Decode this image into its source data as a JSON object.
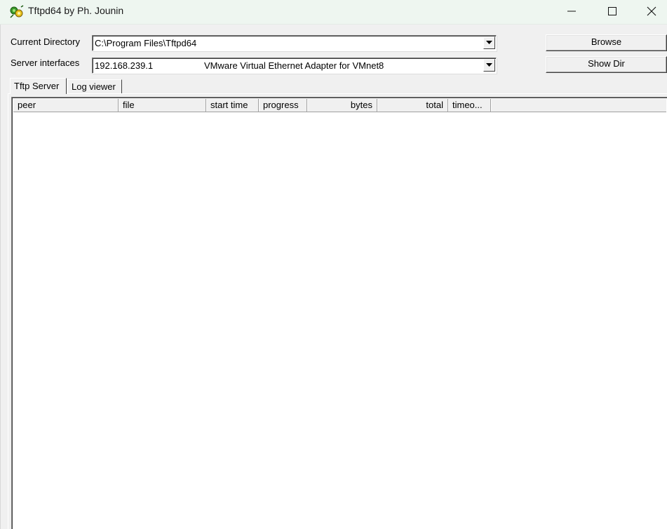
{
  "window": {
    "title": "Tftpd64 by Ph. Jounin",
    "icon": "tftpd64-app-icon",
    "controls": [
      "minimize-icon",
      "maximize-icon",
      "close-icon"
    ]
  },
  "form": {
    "current_directory_label": "Current Directory",
    "current_directory_value": "C:\\Program Files\\Tftpd64",
    "server_interfaces_label": "Server interfaces",
    "server_interface_ip": "192.168.239.1",
    "server_interface_name": "VMware Virtual Ethernet Adapter for VMnet8",
    "browse_label": "Browse",
    "show_dir_label": "Show Dir"
  },
  "tabs": [
    {
      "label": "Tftp Server",
      "active": true
    },
    {
      "label": "Log viewer",
      "active": false
    }
  ],
  "transfers_table": {
    "columns": [
      "peer",
      "file",
      "start time",
      "progress",
      "bytes",
      "total",
      "timeo..."
    ],
    "rows": []
  }
}
